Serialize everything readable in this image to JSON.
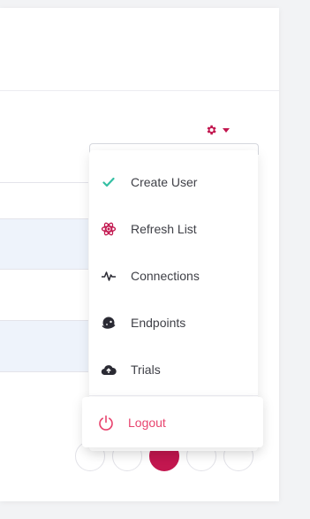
{
  "settings_menu": {
    "items": [
      {
        "label": "Create User",
        "icon": "check-icon"
      },
      {
        "label": "Refresh List",
        "icon": "atom-icon"
      },
      {
        "label": "Connections",
        "icon": "pulse-icon"
      },
      {
        "label": "Endpoints",
        "icon": "planet-icon"
      },
      {
        "label": "Trials",
        "icon": "cloud-upload-icon"
      }
    ],
    "logout_label": "Logout"
  },
  "colors": {
    "accent": "#c2174f",
    "check_green": "#34bfa3",
    "logout_red": "#e8456f",
    "text": "#3f4047"
  },
  "pagination": {
    "active_page_index": 2
  }
}
